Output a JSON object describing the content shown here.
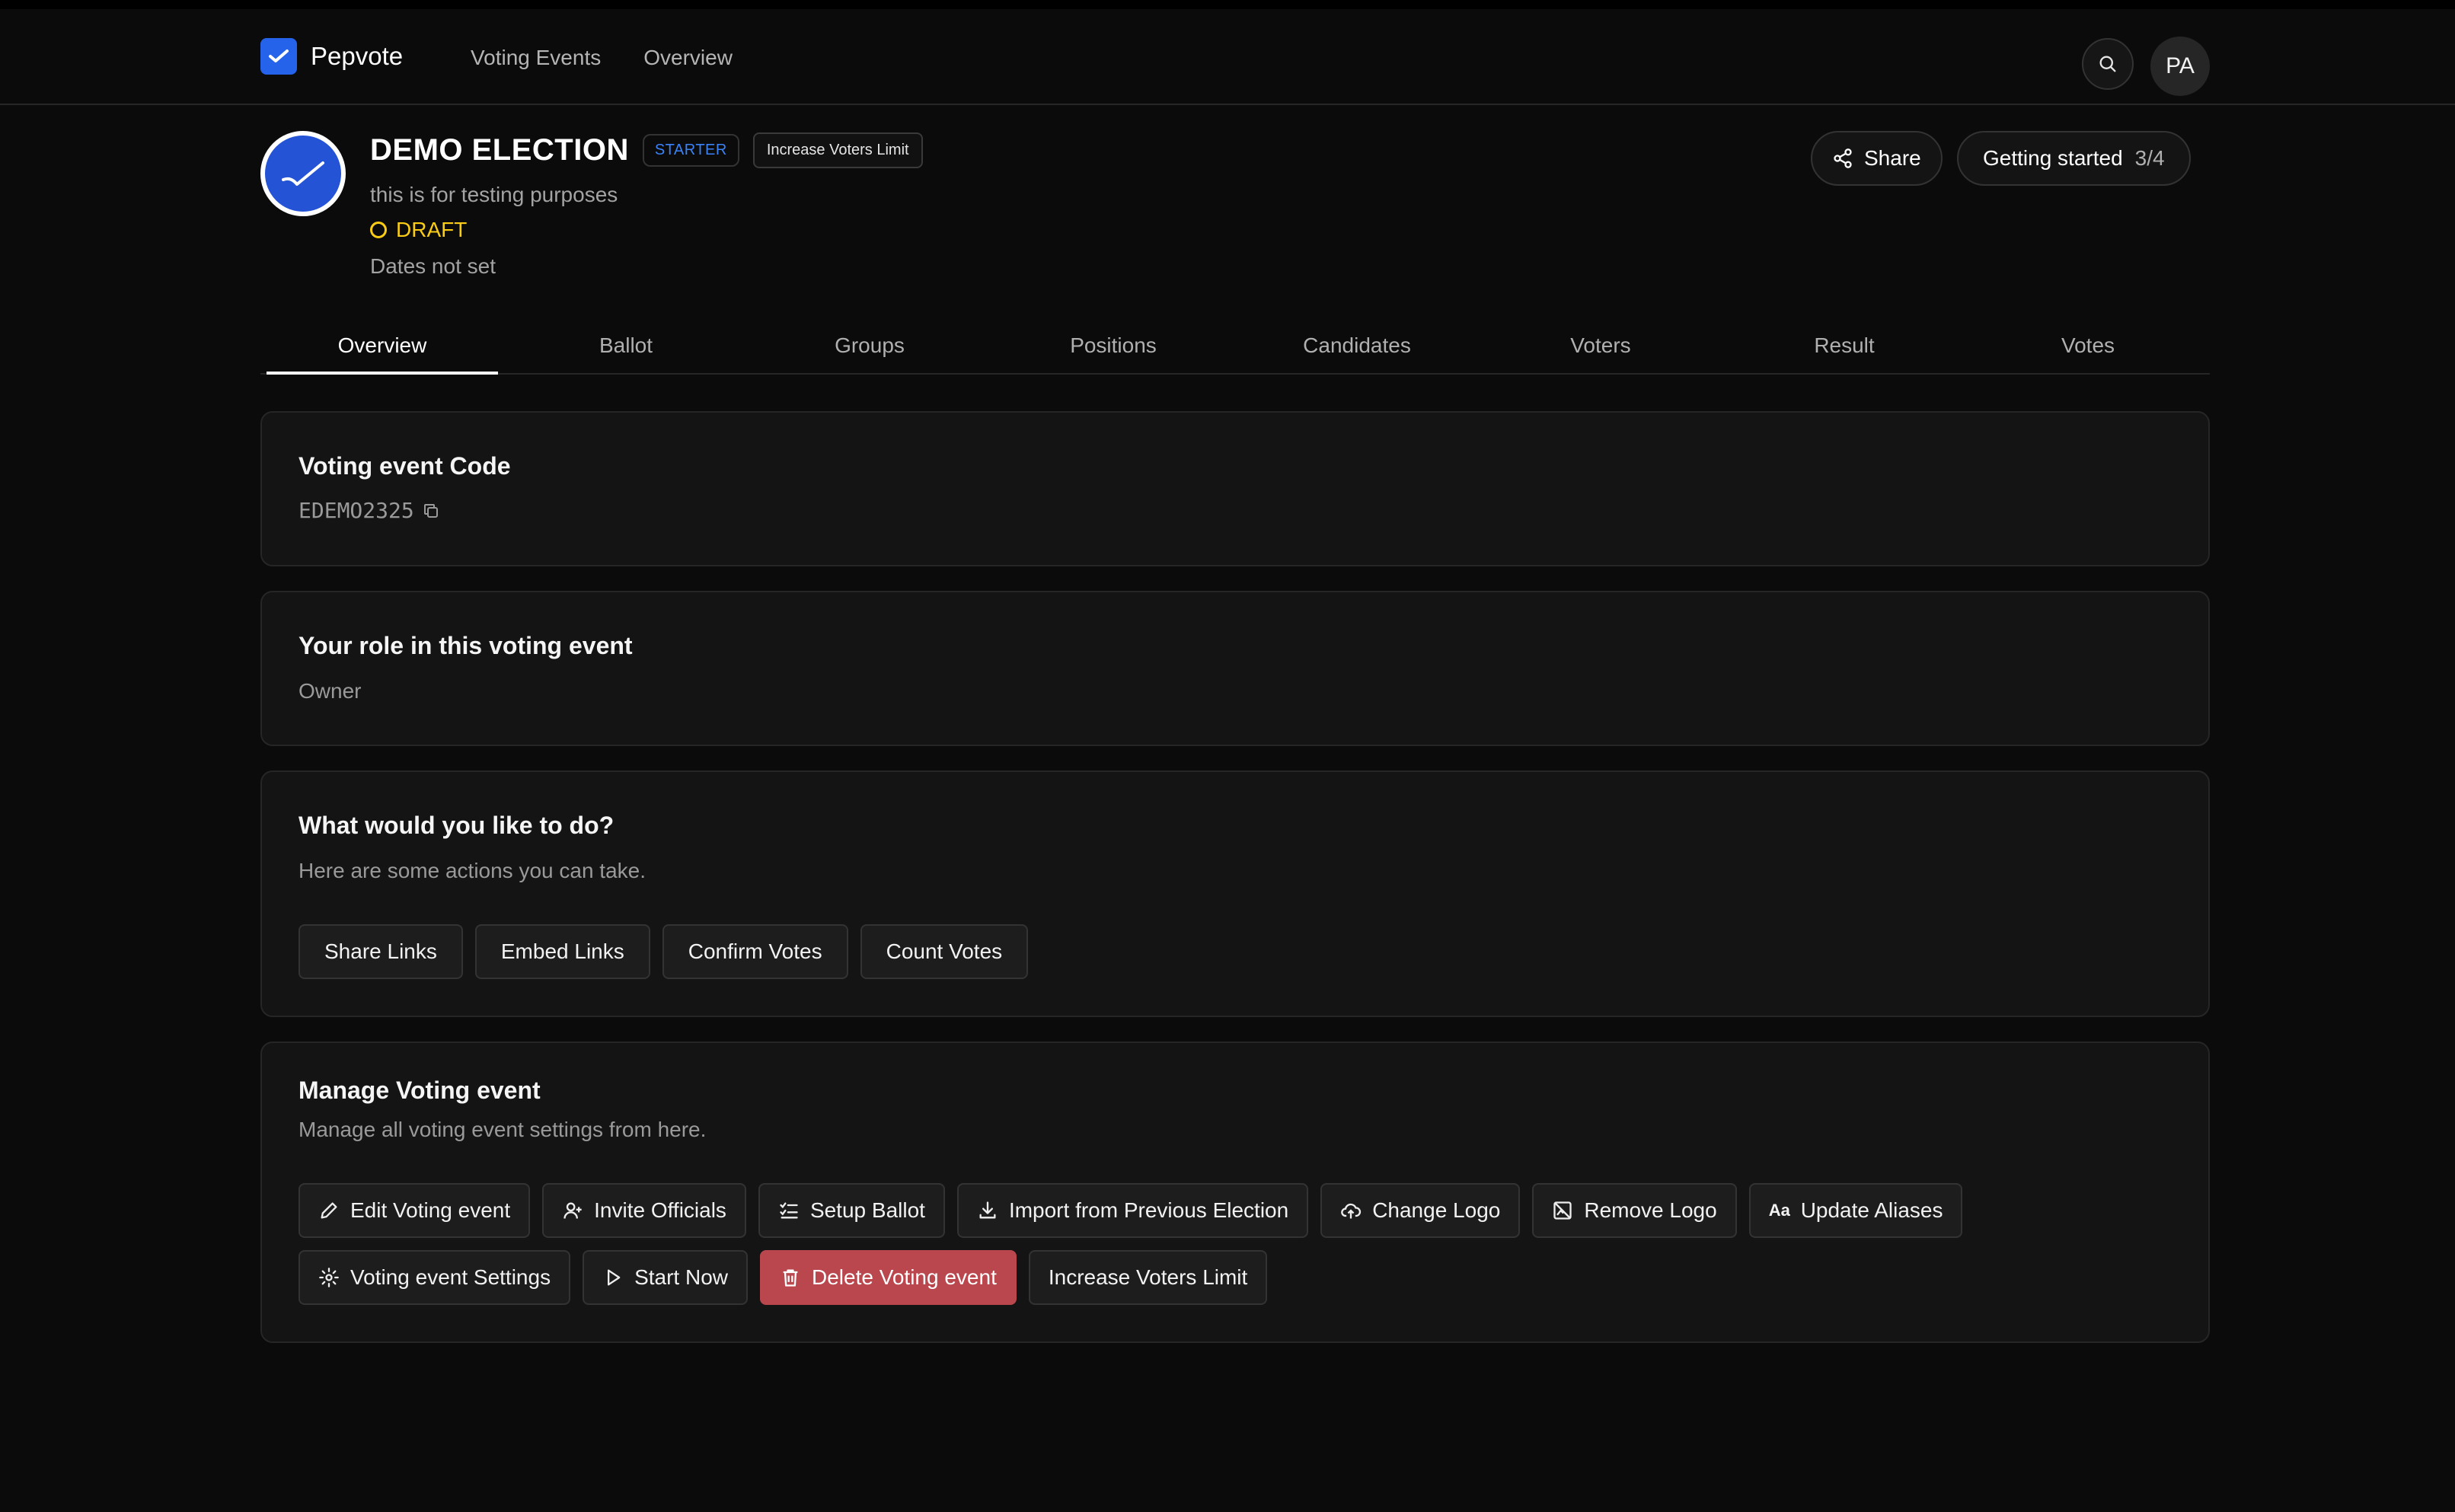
{
  "app": {
    "name": "Pepvote"
  },
  "nav": {
    "links": [
      "Voting Events",
      "Overview"
    ],
    "avatar_initials": "PA"
  },
  "event": {
    "title": "DEMO ELECTION",
    "tier_badge": "STARTER",
    "limit_badge": "Increase Voters Limit",
    "description": "this is for testing purposes",
    "status": "DRAFT",
    "dates": "Dates not set"
  },
  "header_actions": {
    "share": "Share",
    "getting_started": "Getting started",
    "getting_started_progress": "3/4"
  },
  "tabs": [
    "Overview",
    "Ballot",
    "Groups",
    "Positions",
    "Candidates",
    "Voters",
    "Result",
    "Votes"
  ],
  "code_card": {
    "title": "Voting event Code",
    "code": "EDEMO2325"
  },
  "role_card": {
    "title": "Your role in this voting event",
    "role": "Owner"
  },
  "actions_card": {
    "title": "What would you like to do?",
    "subtitle": "Here are some actions you can take.",
    "buttons": [
      "Share Links",
      "Embed Links",
      "Confirm Votes",
      "Count Votes"
    ]
  },
  "manage_card": {
    "title": "Manage Voting event",
    "subtitle": "Manage all voting event settings from here.",
    "row1": [
      {
        "label": "Edit Voting event",
        "icon": "pencil-icon"
      },
      {
        "label": "Invite Officials",
        "icon": "user-plus-icon"
      },
      {
        "label": "Setup Ballot",
        "icon": "checklist-icon"
      },
      {
        "label": "Import from Previous Election",
        "icon": "download-icon"
      },
      {
        "label": "Change Logo",
        "icon": "cloud-upload-icon"
      },
      {
        "label": "Remove Logo",
        "icon": "image-off-icon"
      },
      {
        "label": "Update Aliases",
        "icon": "text-case-icon"
      }
    ],
    "row2": [
      {
        "label": "Voting event Settings",
        "icon": "gear-icon"
      },
      {
        "label": "Start Now",
        "icon": "play-icon"
      },
      {
        "label": "Delete Voting event",
        "icon": "trash-icon"
      },
      {
        "label": "Increase Voters Limit",
        "icon": ""
      }
    ]
  },
  "colors": {
    "accent": "#2563eb",
    "draft": "#facc15",
    "danger": "#b9474d",
    "background": "#0b0b0b",
    "card": "#141414"
  }
}
